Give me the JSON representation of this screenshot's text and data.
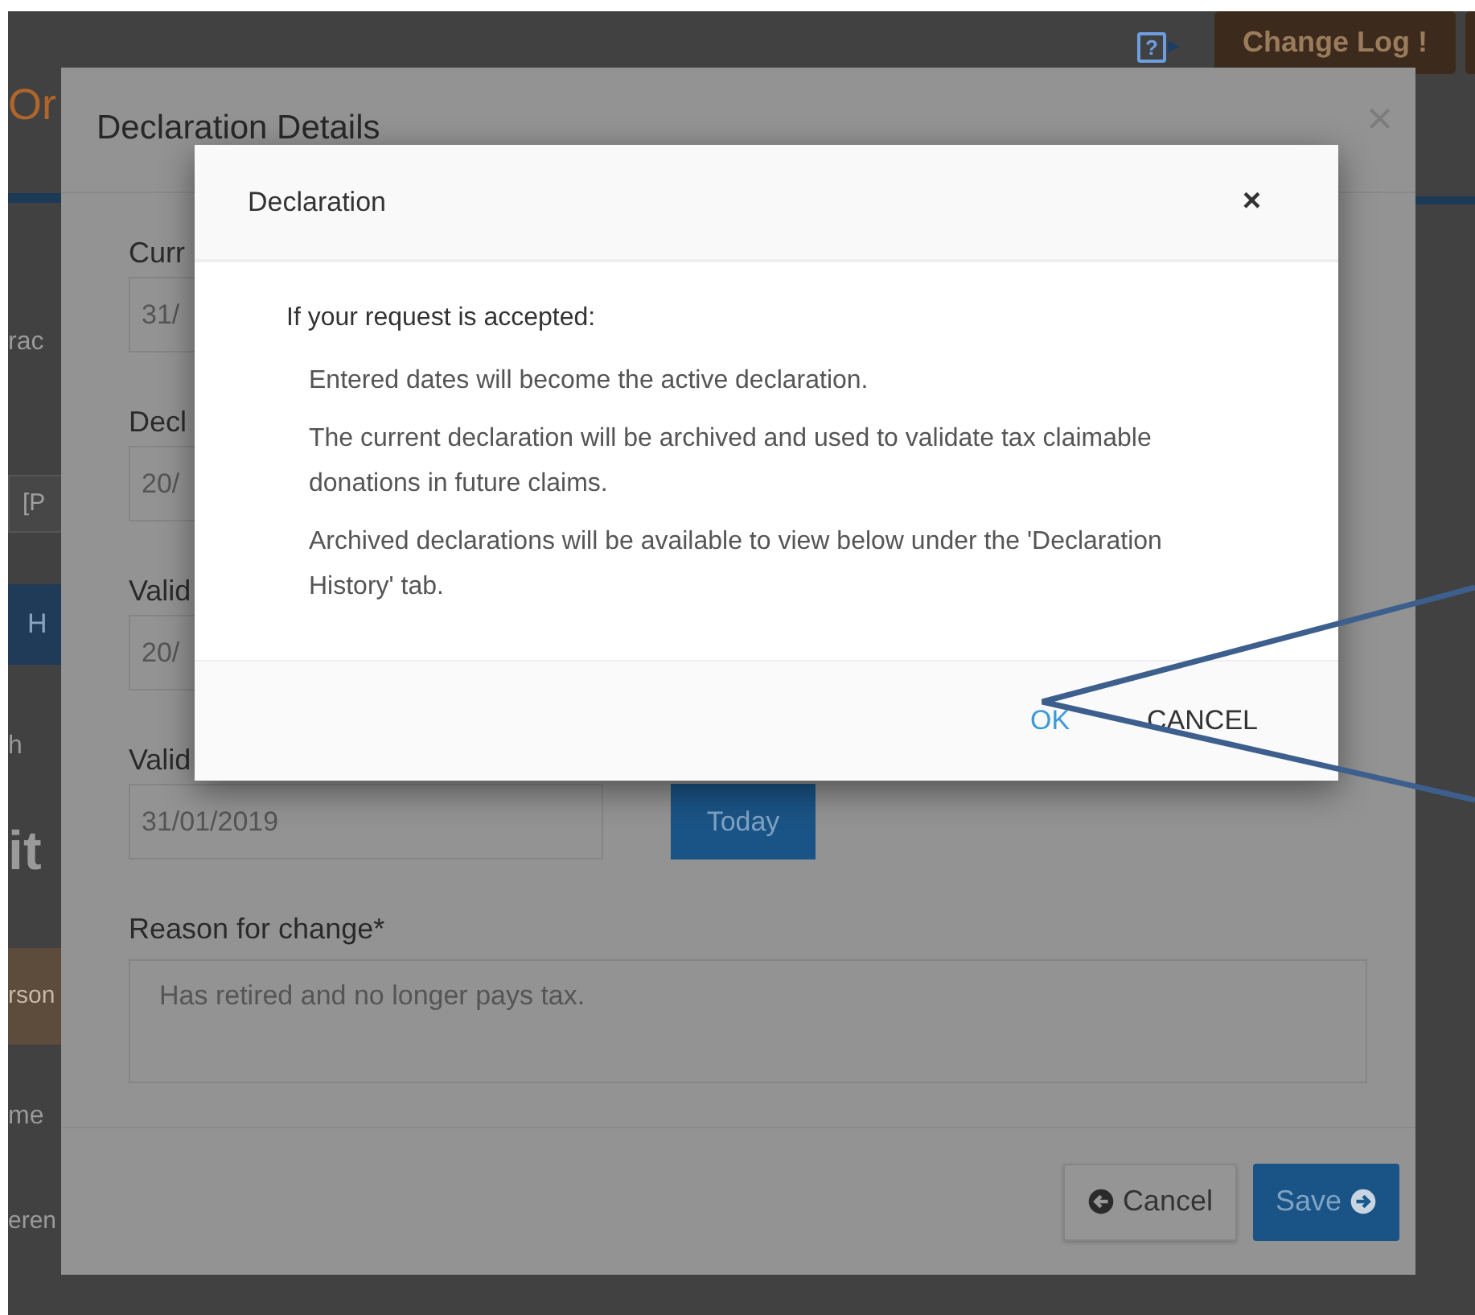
{
  "background_page": {
    "logo": "Or",
    "help_icon_text": "?",
    "change_log_button": "Change Log !",
    "left_fragments": [
      {
        "kind": "text",
        "text": "rac"
      },
      {
        "kind": "input",
        "text": "[P"
      },
      {
        "kind": "tab",
        "text": "H"
      },
      {
        "kind": "text",
        "text": "h"
      },
      {
        "kind": "heading",
        "text": "it"
      },
      {
        "kind": "band",
        "text": "rson"
      },
      {
        "kind": "text",
        "text": "me"
      },
      {
        "kind": "text",
        "text": "eren"
      }
    ]
  },
  "details_modal": {
    "title": "Declaration Details",
    "close": "×",
    "fields": [
      {
        "label": "Curr",
        "value": "31/"
      },
      {
        "label": "Decl",
        "value": "20/"
      },
      {
        "label": "Valid",
        "value": "20/"
      },
      {
        "label": "Valid",
        "value": "31/01/2019",
        "button": "Today"
      }
    ],
    "reason": {
      "label": "Reason for change*",
      "value": "Has retired and no longer pays tax."
    },
    "buttons": [
      {
        "kind": "back",
        "label": "Cancel"
      },
      {
        "kind": "save",
        "label": "Save"
      }
    ]
  },
  "dialog": {
    "title": "Declaration",
    "close": "×",
    "intro": "If your request is accepted:",
    "items": [
      "Entered dates will become the active declaration.",
      "The current declaration will be archived and used to validate tax claimable donations in future claims.",
      "Archived declarations will be available to view below under the 'Declaration History' tab."
    ],
    "buttons": [
      {
        "label": "OK",
        "primary": true
      },
      {
        "label": "CANCEL",
        "primary": false
      }
    ]
  }
}
